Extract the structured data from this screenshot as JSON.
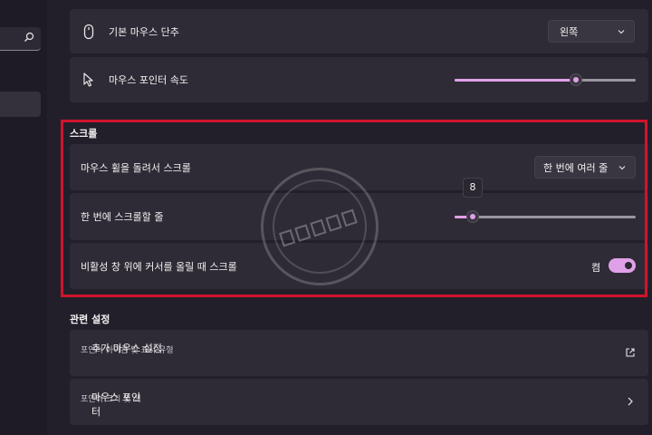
{
  "mouse": {
    "primary_button": {
      "label": "기본 마우스 단추",
      "value": "왼쪽"
    },
    "pointer_speed": {
      "label": "마우스 포인터 속도",
      "level_fraction": 0.67
    }
  },
  "scroll": {
    "title": "스크롤",
    "wheel": {
      "label": "마우스 휠을 돌려서 스크롤",
      "value": "한 번에 여러 줄"
    },
    "lines": {
      "label": "한 번에 스크롤할 줄",
      "value": "8",
      "level_fraction": 0.1
    },
    "inactive": {
      "label": "비활성 창 위에 커서를 올릴 때 스크롤",
      "state": "켬"
    }
  },
  "related": {
    "title": "관련 설정",
    "items": [
      {
        "title": "추가 마우스 설정",
        "subtitle": "포인터 아이콘 및 표시 유형",
        "icon": "external-link-icon"
      },
      {
        "title": "마우스 포인터",
        "subtitle": "포인터 크기 및 색",
        "icon": "chevron-right-icon"
      }
    ]
  },
  "colors": {
    "accent": "#e0a0e8",
    "highlight_box": "#d0142c",
    "card": "#2f2b36",
    "background": "#231f2a"
  }
}
